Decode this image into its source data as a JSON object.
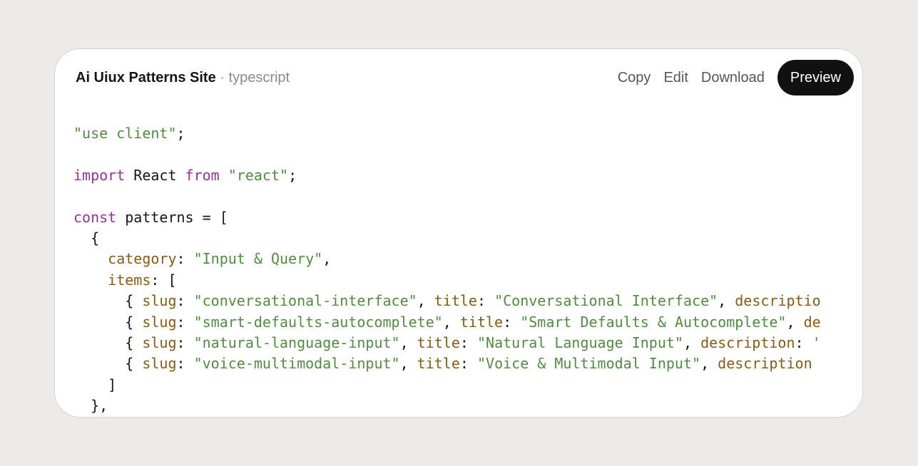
{
  "header": {
    "title": "Ai Uiux Patterns Site",
    "separator": "·",
    "language": "typescript"
  },
  "actions": {
    "copy": "Copy",
    "edit": "Edit",
    "download": "Download",
    "preview": "Preview"
  },
  "colors": {
    "background": "#edebe8",
    "card": "#ffffff",
    "string": "#4f8e3e",
    "keyword": "#9a2f9a",
    "property": "#8a5a14",
    "plain": "#161616",
    "preview_button": "#111111"
  },
  "code_lines": [
    [
      {
        "t": "str",
        "v": "\"use client\""
      },
      {
        "t": "plain",
        "v": ";"
      }
    ],
    [],
    [
      {
        "t": "kw",
        "v": "import"
      },
      {
        "t": "plain",
        "v": " React "
      },
      {
        "t": "kw",
        "v": "from"
      },
      {
        "t": "plain",
        "v": " "
      },
      {
        "t": "str",
        "v": "\"react\""
      },
      {
        "t": "plain",
        "v": ";"
      }
    ],
    [],
    [
      {
        "t": "kw",
        "v": "const"
      },
      {
        "t": "plain",
        "v": " patterns = ["
      }
    ],
    [
      {
        "t": "plain",
        "v": "  {"
      }
    ],
    [
      {
        "t": "plain",
        "v": "    "
      },
      {
        "t": "prop",
        "v": "category"
      },
      {
        "t": "plain",
        "v": ": "
      },
      {
        "t": "str",
        "v": "\"Input & Query\""
      },
      {
        "t": "plain",
        "v": ","
      }
    ],
    [
      {
        "t": "plain",
        "v": "    "
      },
      {
        "t": "prop",
        "v": "items"
      },
      {
        "t": "plain",
        "v": ": ["
      }
    ],
    [
      {
        "t": "plain",
        "v": "      { "
      },
      {
        "t": "prop",
        "v": "slug"
      },
      {
        "t": "plain",
        "v": ": "
      },
      {
        "t": "str",
        "v": "\"conversational-interface\""
      },
      {
        "t": "plain",
        "v": ", "
      },
      {
        "t": "prop",
        "v": "title"
      },
      {
        "t": "plain",
        "v": ": "
      },
      {
        "t": "str",
        "v": "\"Conversational Interface\""
      },
      {
        "t": "plain",
        "v": ", "
      },
      {
        "t": "prop",
        "v": "descriptio"
      }
    ],
    [
      {
        "t": "plain",
        "v": "      { "
      },
      {
        "t": "prop",
        "v": "slug"
      },
      {
        "t": "plain",
        "v": ": "
      },
      {
        "t": "str",
        "v": "\"smart-defaults-autocomplete\""
      },
      {
        "t": "plain",
        "v": ", "
      },
      {
        "t": "prop",
        "v": "title"
      },
      {
        "t": "plain",
        "v": ": "
      },
      {
        "t": "str",
        "v": "\"Smart Defaults & Autocomplete\""
      },
      {
        "t": "plain",
        "v": ", "
      },
      {
        "t": "prop",
        "v": "de"
      }
    ],
    [
      {
        "t": "plain",
        "v": "      { "
      },
      {
        "t": "prop",
        "v": "slug"
      },
      {
        "t": "plain",
        "v": ": "
      },
      {
        "t": "str",
        "v": "\"natural-language-input\""
      },
      {
        "t": "plain",
        "v": ", "
      },
      {
        "t": "prop",
        "v": "title"
      },
      {
        "t": "plain",
        "v": ": "
      },
      {
        "t": "str",
        "v": "\"Natural Language Input\""
      },
      {
        "t": "plain",
        "v": ", "
      },
      {
        "t": "prop",
        "v": "description"
      },
      {
        "t": "plain",
        "v": ": "
      },
      {
        "t": "str",
        "v": "'"
      }
    ],
    [
      {
        "t": "plain",
        "v": "      { "
      },
      {
        "t": "prop",
        "v": "slug"
      },
      {
        "t": "plain",
        "v": ": "
      },
      {
        "t": "str",
        "v": "\"voice-multimodal-input\""
      },
      {
        "t": "plain",
        "v": ", "
      },
      {
        "t": "prop",
        "v": "title"
      },
      {
        "t": "plain",
        "v": ": "
      },
      {
        "t": "str",
        "v": "\"Voice & Multimodal Input\""
      },
      {
        "t": "plain",
        "v": ", "
      },
      {
        "t": "prop",
        "v": "description"
      }
    ],
    [
      {
        "t": "plain",
        "v": "    ]"
      }
    ],
    [
      {
        "t": "plain",
        "v": "  },"
      }
    ]
  ]
}
